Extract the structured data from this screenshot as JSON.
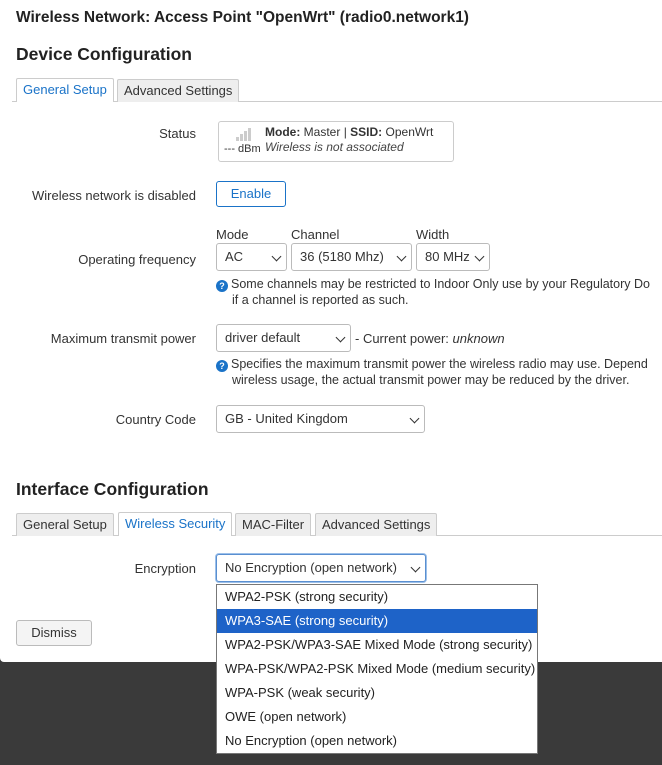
{
  "modal": {
    "title": "Wireless Network: Access Point \"OpenWrt\" (radio0.network1)",
    "dismiss_label": "Dismiss"
  },
  "device": {
    "section_title": "Device Configuration",
    "tabs": [
      "General Setup",
      "Advanced Settings"
    ],
    "status": {
      "label": "Status",
      "dbm": "--- dBm",
      "mode_label": "Mode:",
      "mode_value": "Master",
      "separator": "|",
      "ssid_label": "SSID:",
      "ssid_value": "OpenWrt",
      "assoc": "Wireless is not associated"
    },
    "disabled": {
      "label": "Wireless network is disabled",
      "button": "Enable"
    },
    "frequency": {
      "label": "Operating frequency",
      "mode_caption": "Mode",
      "mode_value": "AC",
      "channel_caption": "Channel",
      "channel_value": "36 (5180 Mhz)",
      "width_caption": "Width",
      "width_value": "80 MHz",
      "help_line1": "Some channels may be restricted to Indoor Only use by your Regulatory Do",
      "help_line2": "if a channel is reported as such."
    },
    "txpower": {
      "label": "Maximum transmit power",
      "value": "driver default",
      "current_prefix": "- Current power:",
      "current_value": "unknown",
      "help_line1": "Specifies the maximum transmit power the wireless radio may use. Depend",
      "help_line2": "wireless usage, the actual transmit power may be reduced by the driver."
    },
    "country": {
      "label": "Country Code",
      "value": "GB - United Kingdom"
    }
  },
  "interface": {
    "section_title": "Interface Configuration",
    "tabs": [
      "General Setup",
      "Wireless Security",
      "MAC-Filter",
      "Advanced Settings"
    ],
    "encryption": {
      "label": "Encryption",
      "value": "No Encryption (open network)",
      "options": [
        "WPA2-PSK (strong security)",
        "WPA3-SAE (strong security)",
        "WPA2-PSK/WPA3-SAE Mixed Mode (strong security)",
        "WPA-PSK/WPA2-PSK Mixed Mode (medium security)",
        "WPA-PSK (weak security)",
        "OWE (open network)",
        "No Encryption (open network)"
      ],
      "highlighted_index": 1
    }
  },
  "icons": {
    "help": "info-circle-icon",
    "signal": "signal-bars-icon",
    "chevron": "chevron-down-icon"
  },
  "colors": {
    "accent": "#1a73c8",
    "highlight": "#1e63c8",
    "backdrop": "#3a3a3a"
  }
}
